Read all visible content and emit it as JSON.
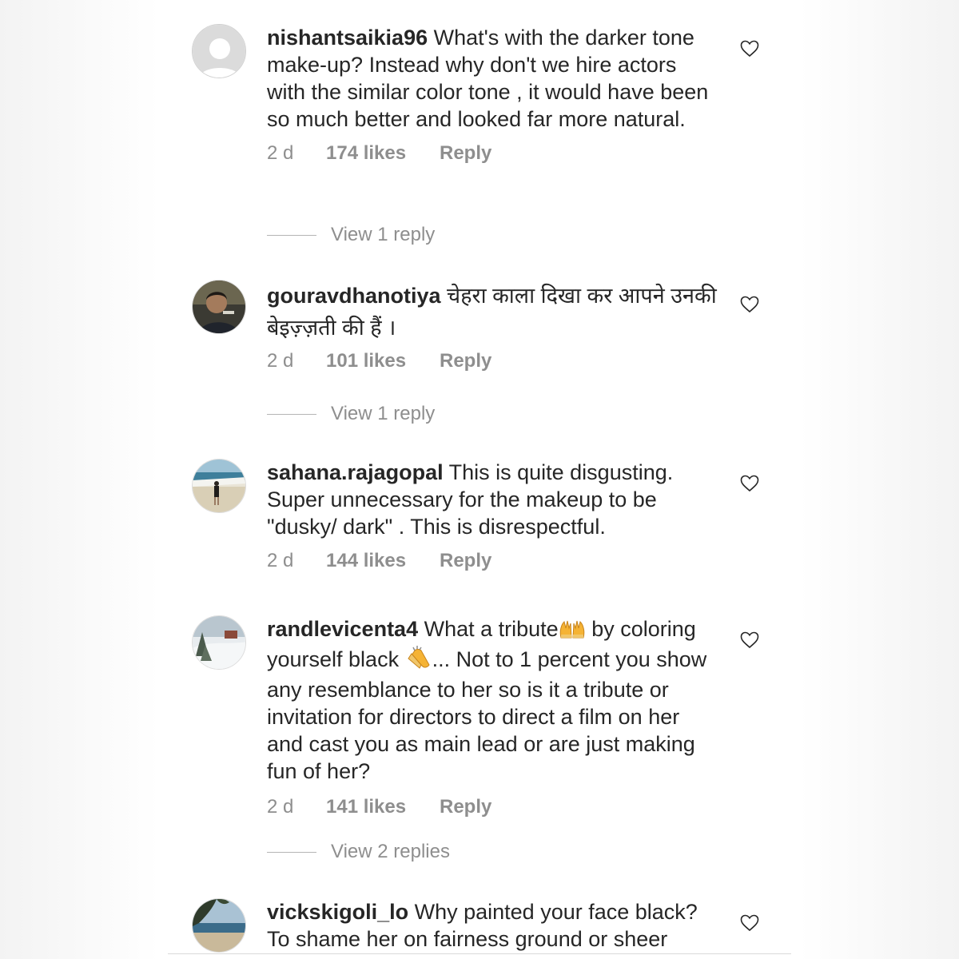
{
  "comments": [
    {
      "username": "nishantsaikia96",
      "text": "What's with the darker tone make-up? Instead why don't we hire actors with the similar color tone , it would have been so much better and looked far more natural.",
      "age": "2 d",
      "likes": "174 likes",
      "reply_label": "Reply",
      "view_replies": "View 1 reply",
      "heart_icon": "heart-outline-icon",
      "avatar": "default-avatar"
    },
    {
      "username": "gouravdhanotiya",
      "text": "चेहरा काला दिखा कर आपने उनकी बेइज़्ज़ती की हैं ।",
      "age": "2 d",
      "likes": "101 likes",
      "reply_label": "Reply",
      "view_replies": "View 1 reply",
      "heart_icon": "heart-outline-icon",
      "avatar": "person-photo"
    },
    {
      "username": "sahana.rajagopal",
      "text": "This is quite disgusting. Super unnecessary for the makeup to be \"dusky/ dark\" . This is disrespectful.",
      "age": "2 d",
      "likes": "144 likes",
      "reply_label": "Reply",
      "heart_icon": "heart-outline-icon",
      "avatar": "beach-photo"
    },
    {
      "username": "randlevicenta4",
      "text_part1": "What a tribute",
      "text_part2": " by coloring yourself black ",
      "text_part3": "... Not to 1 percent you show any resemblance to her so is it a tribute or invitation for directors to direct a film on her and cast you as main lead or are just making fun of her?",
      "emoji1": "raising-hands-emoji",
      "emoji2": "clapping-hands-emoji",
      "age": "2 d",
      "likes": "141 likes",
      "reply_label": "Reply",
      "view_replies": "View 2 replies",
      "heart_icon": "heart-outline-icon",
      "avatar": "snow-landscape-photo"
    },
    {
      "username": "vickskigoli_lo",
      "text": "Why painted your face black? To shame her on fairness ground or sheer",
      "heart_icon": "heart-outline-icon",
      "avatar": "tree-beach-photo"
    }
  ]
}
